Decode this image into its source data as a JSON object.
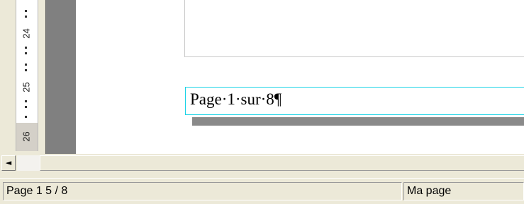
{
  "ruler": {
    "numbers": [
      "24",
      "25",
      "26"
    ]
  },
  "document": {
    "frame_text": "Page·1·sur·8¶"
  },
  "scrollbar": {
    "left_arrow": "◄"
  },
  "statusbar": {
    "page_info": "Page 1   5 / 8",
    "page_style": "Ma page"
  },
  "colors": {
    "frame_border": "#19d3e6",
    "margin_strip": "#808080"
  }
}
